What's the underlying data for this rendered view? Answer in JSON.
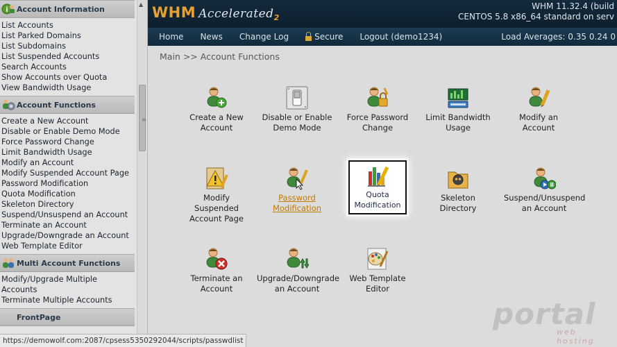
{
  "sidebar": {
    "sections": [
      {
        "title": "Account Information",
        "icon": "info-icon",
        "links": [
          "List Accounts",
          "List Parked Domains",
          "List Subdomains",
          "List Suspended Accounts",
          "Search Accounts",
          "Show Accounts over Quota",
          "View Bandwidth Usage"
        ]
      },
      {
        "title": "Account Functions",
        "icon": "users-gear-icon",
        "links": [
          "Create a New Account",
          "Disable or Enable Demo Mode",
          "Force Password Change",
          "Limit Bandwidth Usage",
          "Modify an Account",
          "Modify Suspended Account Page",
          "Password Modification",
          "Quota Modification",
          "Skeleton Directory",
          "Suspend/Unsuspend an Account",
          "Terminate an Account",
          "Upgrade/Downgrade an Account",
          "Web Template Editor"
        ]
      },
      {
        "title": "Multi Account Functions",
        "icon": "users-group-icon",
        "links": [
          "Modify/Upgrade Multiple",
          "Accounts",
          "Terminate Multiple Accounts"
        ]
      },
      {
        "title": "FrontPage",
        "icon": "frontpage-icon",
        "links": []
      }
    ]
  },
  "status_url": "https://demowolf.com:2087/cpsess5350292044/scripts/passwdlist",
  "header": {
    "logo_main": "WHM",
    "logo_accelerated": "Accelerated",
    "logo_version_mark": "2",
    "version_line": "WHM 11.32.4 (build",
    "os_line": "CENTOS 5.8 x86_64 standard on serv"
  },
  "nav": {
    "items": [
      "Home",
      "News",
      "Change Log",
      "Secure",
      "Logout (demo1234)"
    ],
    "load_averages": "Load Averages: 0.35 0.24 0"
  },
  "main": {
    "breadcrumb": "Main >> Account Functions",
    "tiles": [
      {
        "name": "create-account",
        "line1": "Create a New",
        "line2": "Account",
        "line3": "",
        "icon": "user-add-icon"
      },
      {
        "name": "demo-mode",
        "line1": "Disable or Enable",
        "line2": "Demo Mode",
        "line3": "",
        "icon": "switch-icon"
      },
      {
        "name": "force-password",
        "line1": "Force Password",
        "line2": "Change",
        "line3": "",
        "icon": "user-lock-icon"
      },
      {
        "name": "limit-bandwidth",
        "line1": "Limit Bandwidth",
        "line2": "Usage",
        "line3": "",
        "icon": "bandwidth-icon"
      },
      {
        "name": "modify-account",
        "line1": "Modify an",
        "line2": "Account",
        "line3": "",
        "icon": "user-edit-icon"
      },
      {
        "name": "modify-suspended",
        "line1": "Modify",
        "line2": "Suspended",
        "line3": "Account Page",
        "icon": "warning-edit-icon"
      },
      {
        "name": "password-modification",
        "line1": "Password",
        "line2": "Modification",
        "line3": "",
        "icon": "user-key-icon"
      },
      {
        "name": "skeleton-directory",
        "line1": "Skeleton",
        "line2": "Directory",
        "line3": "",
        "icon": "skull-folder-icon"
      },
      {
        "name": "suspend-account",
        "line1": "Suspend/Unsuspend",
        "line2": "an Account",
        "line3": "",
        "icon": "user-pause-icon"
      },
      {
        "name": "terminate-account",
        "line1": "Terminate an",
        "line2": "Account",
        "line3": "",
        "icon": "user-delete-icon"
      },
      {
        "name": "upgrade-downgrade",
        "line1": "Upgrade/Downgrade",
        "line2": "an Account",
        "line3": "",
        "icon": "user-updown-icon"
      },
      {
        "name": "web-template",
        "line1": "Web Template",
        "line2": "Editor",
        "line3": "",
        "icon": "palette-icon"
      }
    ],
    "highlighted": {
      "line1": "Quota",
      "line2": "Modification",
      "icon": "quota-bars-icon"
    }
  },
  "watermark": {
    "text": "portal",
    "sub": "web hosting"
  }
}
